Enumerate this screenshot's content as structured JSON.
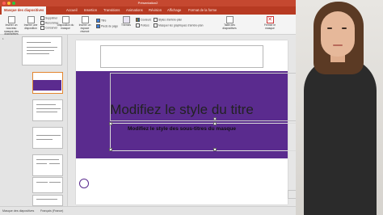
{
  "app": {
    "document_title": "Présentation2",
    "tabs": [
      {
        "label": "Masque des diapositives",
        "active": true
      },
      {
        "label": "Accueil"
      },
      {
        "label": "Insertion"
      },
      {
        "label": "Transitions"
      },
      {
        "label": "Animations"
      },
      {
        "label": "Révision"
      },
      {
        "label": "Affichage"
      },
      {
        "label": "Format de la forme"
      }
    ],
    "ribbon": {
      "insert_master": "Insérer un nouveau masque des diapositives",
      "insert_layout": "Insérer une disposition",
      "delete": "Supprimer",
      "rename": "Renommer",
      "preserve": "Conserver",
      "master_layout": "Disposition du masque",
      "insert_placeholder": "Insérer un espace réservé",
      "title_check": "Titre",
      "footers_check": "Pieds de page",
      "themes": "Thèmes",
      "colors": "Couleurs",
      "fonts": "Polices",
      "background_styles": "Styles d'arrière-plan",
      "hide_background": "Masquer les graphiques d'arrière-plan",
      "slide_size": "Taille des diapositives",
      "close_master": "Fermer le masque"
    },
    "slide": {
      "title": "Modifiez le style du titre",
      "subtitle": "Modifiez le style des sous-titres du masque",
      "footer_number": "‹#›",
      "band_color": "#5a2b8e"
    },
    "thumbnail_numbers": [
      "1",
      "2",
      "3",
      "4",
      "5",
      "6",
      "7",
      "8"
    ],
    "status": {
      "view": "Masque des diapositives",
      "language": "Français (France)"
    },
    "colors": {
      "accent": "#b73a22",
      "selection": "#e3862f"
    }
  }
}
